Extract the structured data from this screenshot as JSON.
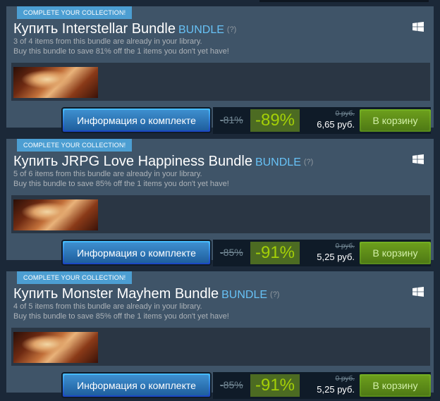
{
  "bundles": [
    {
      "tag": "COMPLETE YOUR COLLECTION!",
      "title": "Купить Interstellar Bundle",
      "kind": "BUNDLE",
      "help": "(?)",
      "line1": "3 of 4 items from this bundle are already in your library.",
      "line2": "Buy this bundle to save 81% off the 1 items you don't yet have!",
      "info_label": "Информация о комплекте",
      "bundle_discount": "-81%",
      "discount": "-89%",
      "original_price": "0 руб.",
      "final_price": "6,65 руб.",
      "cart_label": "В корзину"
    },
    {
      "tag": "COMPLETE YOUR COLLECTION!",
      "title": "Купить JRPG Love Happiness Bundle",
      "kind": "BUNDLE",
      "help": "(?)",
      "line1": "5 of 6 items from this bundle are already in your library.",
      "line2": "Buy this bundle to save 85% off the 1 items you don't yet have!",
      "info_label": "Информация о комплекте",
      "bundle_discount": "-85%",
      "discount": "-91%",
      "original_price": "0 руб.",
      "final_price": "5,25 руб.",
      "cart_label": "В корзину"
    },
    {
      "tag": "COMPLETE YOUR COLLECTION!",
      "title": "Купить Monster Mayhem Bundle",
      "kind": "BUNDLE",
      "help": "(?)",
      "line1": "4 of 5 items from this bundle are already in your library.",
      "line2": "Buy this bundle to save 85% off the 1 items you don't yet have!",
      "info_label": "Информация о комплекте",
      "bundle_discount": "-85%",
      "discount": "-91%",
      "original_price": "0 руб.",
      "final_price": "5,25 руб.",
      "cart_label": "В корзину"
    }
  ],
  "icons": {
    "platform": "windows-icon",
    "thumbnail": "game-thumbnail-image"
  },
  "colors": {
    "background": "#1b2838",
    "panel": "#3f5468",
    "accent": "#67c1f5",
    "discount_bg": "#4c6b22",
    "discount_text": "#a4d007",
    "cart": "#6c9e1c"
  }
}
